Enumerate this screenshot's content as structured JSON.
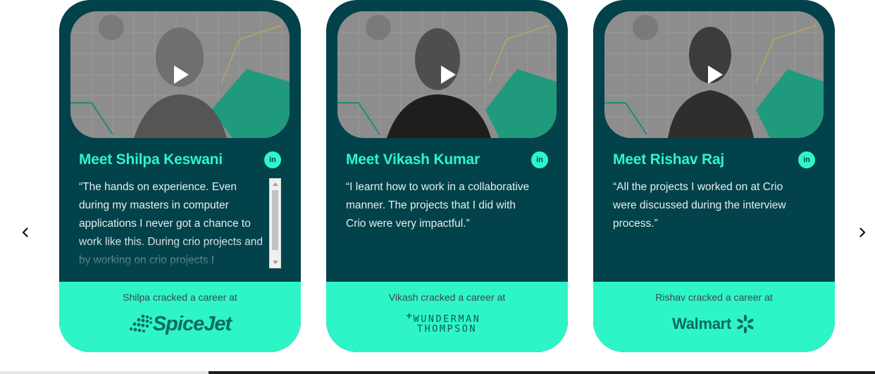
{
  "carousel": {
    "prev_icon": "chevron-left-icon",
    "next_icon": "chevron-right-icon",
    "progress_fraction": 0.238
  },
  "cards": [
    {
      "name": "Meet Shilpa Keswani",
      "linkedin": "in",
      "quote": "“The hands on experience. Even during my masters in computer applications I never got a chance to work like this. During crio projects and by working on crio projects I",
      "footer": "Shilpa cracked a career at",
      "company_logo_text": "SpiceJet"
    },
    {
      "name": "Meet Vikash Kumar",
      "linkedin": "in",
      "quote": "“I learnt how to work in a collaborative manner. The projects that I did with Crio were very impactful.”",
      "footer": "Vikash cracked a career at",
      "company_logo_text_line1": "WUNDERMAN",
      "company_logo_text_line2": "THOMPSON"
    },
    {
      "name": "Meet Rishav Raj",
      "linkedin": "in",
      "quote": "“All the projects I worked on at Crio were discussed during the interview process.”",
      "footer": "Rishav cracked a career at",
      "company_logo_text": "Walmart"
    }
  ],
  "colors": {
    "card_bg": "#02424a",
    "accent": "#2ef5c8"
  }
}
